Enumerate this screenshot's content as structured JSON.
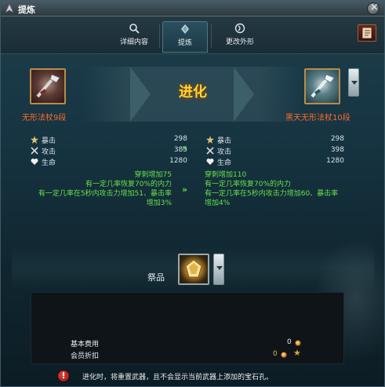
{
  "window": {
    "title": "提炼"
  },
  "tabs": [
    {
      "label": "详细内容",
      "icon": "magnifier-icon"
    },
    {
      "label": "提炼",
      "icon": "refine-icon"
    },
    {
      "label": "更改外形",
      "icon": "change-appearance-icon"
    }
  ],
  "evolve": {
    "label": "进化",
    "source_item": "无形法杖9段",
    "target_item": "黑天无形法杖10段"
  },
  "stats_left": [
    {
      "name": "暴击",
      "value": "298",
      "icon": "crit-star-icon"
    },
    {
      "name": "攻击",
      "value": "385",
      "icon": "crossed-swords-icon"
    },
    {
      "name": "生命",
      "value": "1280",
      "icon": "heart-icon"
    }
  ],
  "stats_right": [
    {
      "name": "暴击",
      "value": "298",
      "icon": "crit-star-icon"
    },
    {
      "name": "攻击",
      "value": "398",
      "icon": "crossed-swords-icon"
    },
    {
      "name": "生命",
      "value": "1280",
      "icon": "heart-icon"
    }
  ],
  "arrow": "»",
  "effects_left": [
    "穿刺增加75",
    "有一定几率恢复70%的内力",
    "有一定几率在5秒内攻击力增加51、暴击率",
    "增加3%"
  ],
  "effects_right": [
    "穿刺增加110",
    "有一定几率恢复70%的内力",
    "有一定几率在5秒内攻击力增加60、暴击率",
    "增加4%"
  ],
  "sacrifice": {
    "label": "祭品"
  },
  "costs": {
    "base_fee_label": "基本费用",
    "base_fee_value": "0",
    "member_discount_label": "会员折扣",
    "member_discount_value": "0"
  },
  "warning": {
    "text": "进化时，将重置武器，且不会显示当前武器上添加的宝石孔。"
  },
  "colors": {
    "accent_gold": "#ffd23a",
    "item_name": "#ff6a2a",
    "effect_green": "#66e04a"
  }
}
